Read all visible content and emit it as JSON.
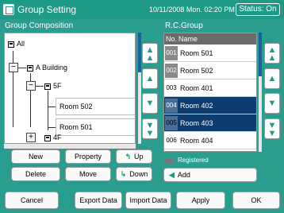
{
  "header": {
    "title": "Group Setting",
    "datetime": "10/11/2008 Mon. 02:20 PM",
    "status": "Status: On"
  },
  "left": {
    "label": "Group Composition",
    "tree": {
      "root": "All",
      "building": "A Building",
      "floor5": "5F",
      "room502": "Room 502",
      "room501": "Room 501",
      "floor4": "4F"
    },
    "buttons": {
      "new": "New",
      "property": "Property",
      "up": "Up",
      "delete": "Delete",
      "move": "Move",
      "down": "Down"
    }
  },
  "right": {
    "label": "R.C.Group",
    "columns": [
      "No.",
      "Name"
    ],
    "rows": [
      {
        "no": "001",
        "name": "Room 501",
        "registered": true,
        "selected": false
      },
      {
        "no": "002",
        "name": "Room 502",
        "registered": true,
        "selected": false
      },
      {
        "no": "003",
        "name": "Room 401",
        "registered": false,
        "selected": false
      },
      {
        "no": "004",
        "name": "Room 402",
        "registered": true,
        "selected": true
      },
      {
        "no": "005",
        "name": "Room 403",
        "registered": false,
        "selected": true
      },
      {
        "no": "006",
        "name": "Room 404",
        "registered": false,
        "selected": false
      }
    ],
    "legend": "Registered",
    "add": "Add"
  },
  "footer": {
    "cancel": "Cancel",
    "export": "Export Data",
    "import": "Import Data",
    "apply": "Apply",
    "ok": "OK"
  },
  "colors": {
    "background": "#2a9d8f",
    "selected_row": "#0c3d6e",
    "accent_arrow": "#1f9a86"
  },
  "icons": {
    "scroll_top": "double-up-arrow-icon",
    "scroll_up": "up-arrow-icon",
    "scroll_down": "down-arrow-icon",
    "scroll_bottom": "double-down-arrow-icon"
  }
}
